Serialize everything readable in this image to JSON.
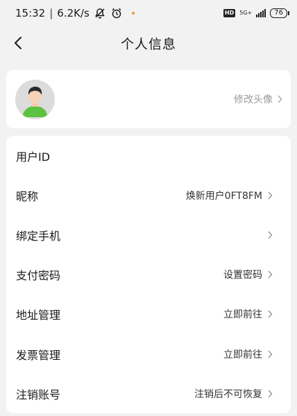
{
  "status_bar": {
    "time": "15:32",
    "net_speed": "6.2K/s",
    "hd": "HD",
    "network": "5G+",
    "battery": "76"
  },
  "header": {
    "title": "个人信息"
  },
  "avatar_card": {
    "change_label": "修改头像"
  },
  "rows": [
    {
      "label": "用户ID",
      "value": ""
    },
    {
      "label": "昵称",
      "value": "焕新用户0FT8FM"
    },
    {
      "label": "绑定手机",
      "value": ""
    },
    {
      "label": "支付密码",
      "value": "设置密码"
    },
    {
      "label": "地址管理",
      "value": "立即前往"
    },
    {
      "label": "发票管理",
      "value": "立即前往"
    },
    {
      "label": "注销账号",
      "value": "注销后不可恢复"
    }
  ],
  "colors": {
    "background": "#f2f2f2",
    "card": "#ffffff",
    "avatar_shirt": "#5cc23f",
    "muted_text": "#9a9a9a"
  }
}
